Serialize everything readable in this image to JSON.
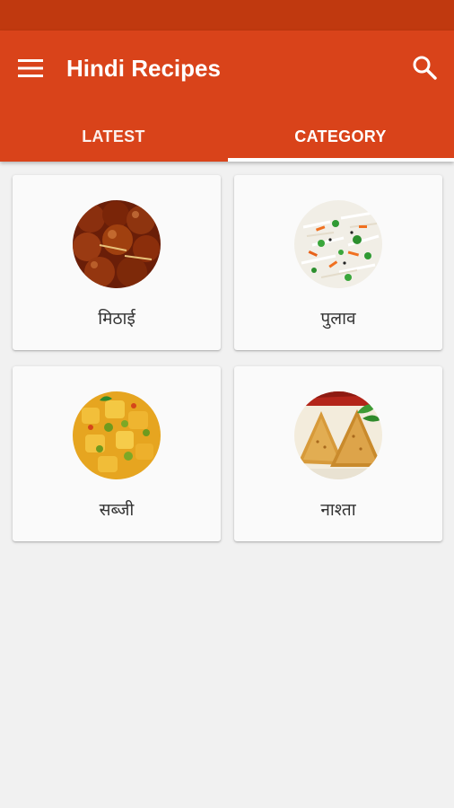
{
  "colors": {
    "status_bar": "#c0390f",
    "app_bar": "#d9431a",
    "background": "#f1f1f1",
    "card": "#fafafa"
  },
  "app_bar": {
    "title": "Hindi Recipes",
    "menu_icon": "hamburger-menu-icon",
    "search_icon": "search-icon"
  },
  "tabs": [
    {
      "label": "LATEST",
      "selected": false
    },
    {
      "label": "CATEGORY",
      "selected": true
    }
  ],
  "categories": [
    {
      "label": "मिठाई",
      "image": "gulab-jamun-image"
    },
    {
      "label": "पुलाव",
      "image": "pulao-image"
    },
    {
      "label": "सब्जी",
      "image": "sabzi-image"
    },
    {
      "label": "नाश्ता",
      "image": "samosa-image"
    }
  ]
}
